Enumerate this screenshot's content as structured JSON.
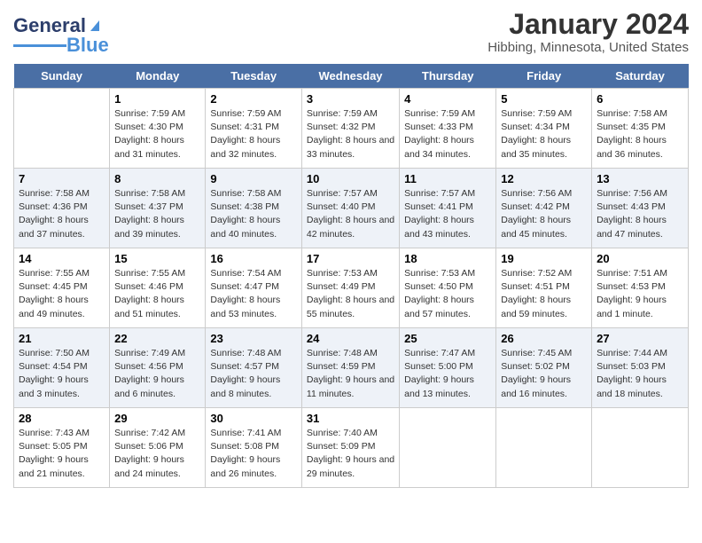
{
  "header": {
    "logo_general": "General",
    "logo_blue": "Blue",
    "month_year": "January 2024",
    "location": "Hibbing, Minnesota, United States"
  },
  "days_of_week": [
    "Sunday",
    "Monday",
    "Tuesday",
    "Wednesday",
    "Thursday",
    "Friday",
    "Saturday"
  ],
  "weeks": [
    [
      {
        "date": "",
        "info": ""
      },
      {
        "date": "1",
        "info": "Sunrise: 7:59 AM\nSunset: 4:30 PM\nDaylight: 8 hours and 31 minutes."
      },
      {
        "date": "2",
        "info": "Sunrise: 7:59 AM\nSunset: 4:31 PM\nDaylight: 8 hours and 32 minutes."
      },
      {
        "date": "3",
        "info": "Sunrise: 7:59 AM\nSunset: 4:32 PM\nDaylight: 8 hours and 33 minutes."
      },
      {
        "date": "4",
        "info": "Sunrise: 7:59 AM\nSunset: 4:33 PM\nDaylight: 8 hours and 34 minutes."
      },
      {
        "date": "5",
        "info": "Sunrise: 7:59 AM\nSunset: 4:34 PM\nDaylight: 8 hours and 35 minutes."
      },
      {
        "date": "6",
        "info": "Sunrise: 7:58 AM\nSunset: 4:35 PM\nDaylight: 8 hours and 36 minutes."
      }
    ],
    [
      {
        "date": "7",
        "info": "Sunrise: 7:58 AM\nSunset: 4:36 PM\nDaylight: 8 hours and 37 minutes."
      },
      {
        "date": "8",
        "info": "Sunrise: 7:58 AM\nSunset: 4:37 PM\nDaylight: 8 hours and 39 minutes."
      },
      {
        "date": "9",
        "info": "Sunrise: 7:58 AM\nSunset: 4:38 PM\nDaylight: 8 hours and 40 minutes."
      },
      {
        "date": "10",
        "info": "Sunrise: 7:57 AM\nSunset: 4:40 PM\nDaylight: 8 hours and 42 minutes."
      },
      {
        "date": "11",
        "info": "Sunrise: 7:57 AM\nSunset: 4:41 PM\nDaylight: 8 hours and 43 minutes."
      },
      {
        "date": "12",
        "info": "Sunrise: 7:56 AM\nSunset: 4:42 PM\nDaylight: 8 hours and 45 minutes."
      },
      {
        "date": "13",
        "info": "Sunrise: 7:56 AM\nSunset: 4:43 PM\nDaylight: 8 hours and 47 minutes."
      }
    ],
    [
      {
        "date": "14",
        "info": "Sunrise: 7:55 AM\nSunset: 4:45 PM\nDaylight: 8 hours and 49 minutes."
      },
      {
        "date": "15",
        "info": "Sunrise: 7:55 AM\nSunset: 4:46 PM\nDaylight: 8 hours and 51 minutes."
      },
      {
        "date": "16",
        "info": "Sunrise: 7:54 AM\nSunset: 4:47 PM\nDaylight: 8 hours and 53 minutes."
      },
      {
        "date": "17",
        "info": "Sunrise: 7:53 AM\nSunset: 4:49 PM\nDaylight: 8 hours and 55 minutes."
      },
      {
        "date": "18",
        "info": "Sunrise: 7:53 AM\nSunset: 4:50 PM\nDaylight: 8 hours and 57 minutes."
      },
      {
        "date": "19",
        "info": "Sunrise: 7:52 AM\nSunset: 4:51 PM\nDaylight: 8 hours and 59 minutes."
      },
      {
        "date": "20",
        "info": "Sunrise: 7:51 AM\nSunset: 4:53 PM\nDaylight: 9 hours and 1 minute."
      }
    ],
    [
      {
        "date": "21",
        "info": "Sunrise: 7:50 AM\nSunset: 4:54 PM\nDaylight: 9 hours and 3 minutes."
      },
      {
        "date": "22",
        "info": "Sunrise: 7:49 AM\nSunset: 4:56 PM\nDaylight: 9 hours and 6 minutes."
      },
      {
        "date": "23",
        "info": "Sunrise: 7:48 AM\nSunset: 4:57 PM\nDaylight: 9 hours and 8 minutes."
      },
      {
        "date": "24",
        "info": "Sunrise: 7:48 AM\nSunset: 4:59 PM\nDaylight: 9 hours and 11 minutes."
      },
      {
        "date": "25",
        "info": "Sunrise: 7:47 AM\nSunset: 5:00 PM\nDaylight: 9 hours and 13 minutes."
      },
      {
        "date": "26",
        "info": "Sunrise: 7:45 AM\nSunset: 5:02 PM\nDaylight: 9 hours and 16 minutes."
      },
      {
        "date": "27",
        "info": "Sunrise: 7:44 AM\nSunset: 5:03 PM\nDaylight: 9 hours and 18 minutes."
      }
    ],
    [
      {
        "date": "28",
        "info": "Sunrise: 7:43 AM\nSunset: 5:05 PM\nDaylight: 9 hours and 21 minutes."
      },
      {
        "date": "29",
        "info": "Sunrise: 7:42 AM\nSunset: 5:06 PM\nDaylight: 9 hours and 24 minutes."
      },
      {
        "date": "30",
        "info": "Sunrise: 7:41 AM\nSunset: 5:08 PM\nDaylight: 9 hours and 26 minutes."
      },
      {
        "date": "31",
        "info": "Sunrise: 7:40 AM\nSunset: 5:09 PM\nDaylight: 9 hours and 29 minutes."
      },
      {
        "date": "",
        "info": ""
      },
      {
        "date": "",
        "info": ""
      },
      {
        "date": "",
        "info": ""
      }
    ]
  ]
}
